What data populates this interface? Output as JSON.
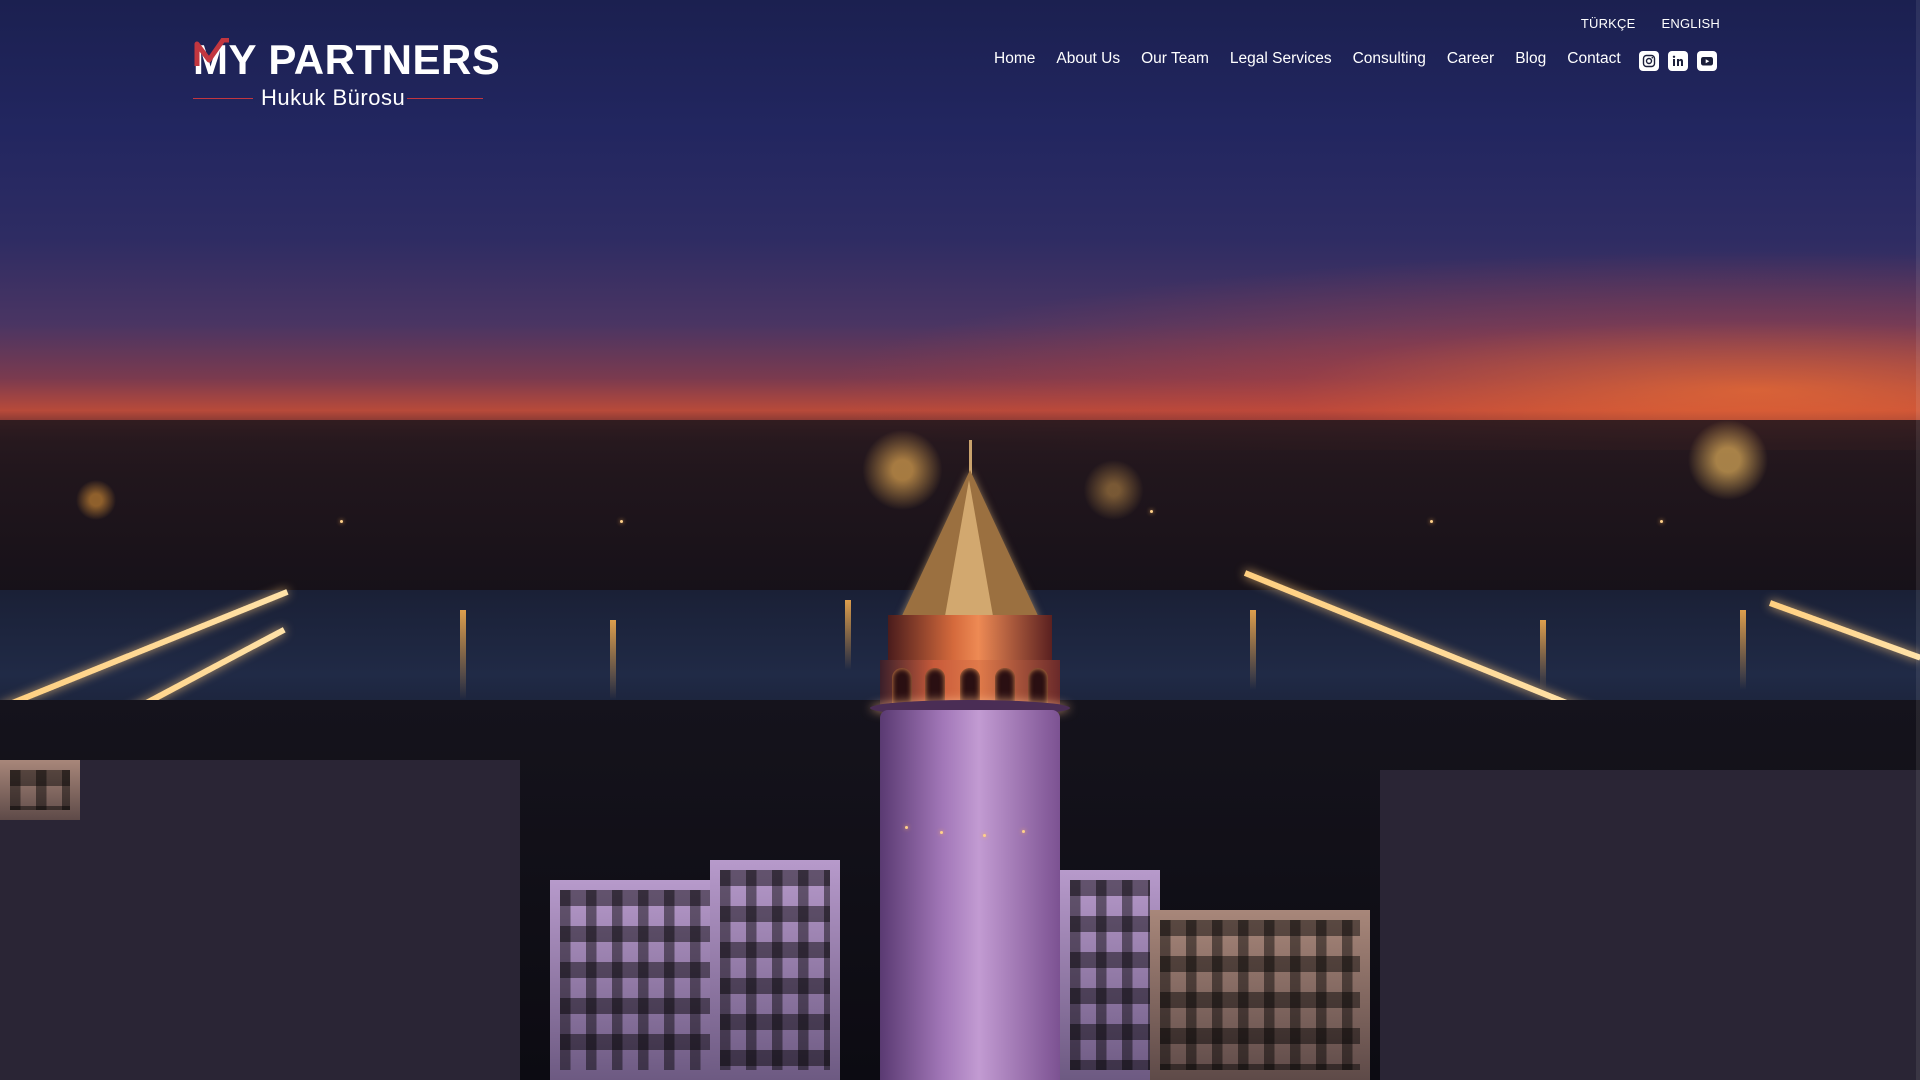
{
  "brand": {
    "name": "MY PARTNERS",
    "subtitle": "Hukuk Bürosu",
    "accent_color": "#c2363f"
  },
  "languages": [
    {
      "label": "TÜRKÇE"
    },
    {
      "label": "ENGLISH"
    }
  ],
  "nav": {
    "items": [
      {
        "label": "Home"
      },
      {
        "label": "About Us"
      },
      {
        "label": "Our Team"
      },
      {
        "label": "Legal Services"
      },
      {
        "label": "Consulting"
      },
      {
        "label": "Career"
      },
      {
        "label": "Blog"
      },
      {
        "label": "Contact"
      }
    ]
  },
  "social": [
    {
      "icon": "instagram-icon"
    },
    {
      "icon": "linkedin-icon"
    },
    {
      "icon": "youtube-icon"
    }
  ],
  "hero": {
    "image_subject": "galata-tower-night-icon"
  }
}
